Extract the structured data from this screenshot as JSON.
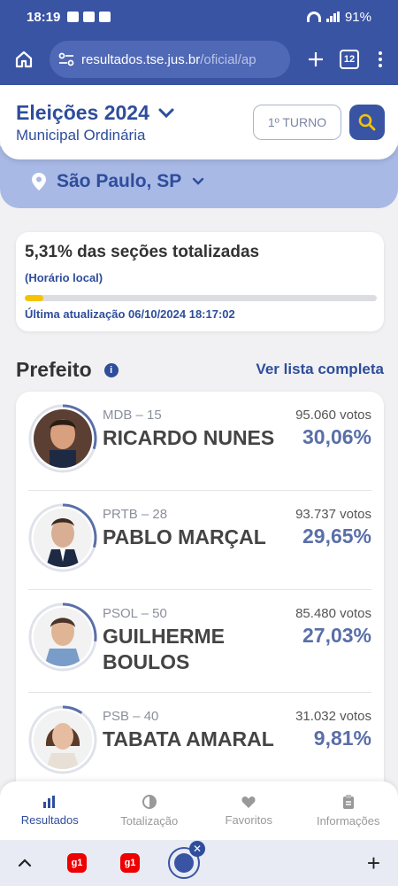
{
  "status_bar": {
    "time": "18:19",
    "battery": "91%"
  },
  "browser": {
    "url_host": "resultados.tse.jus.br",
    "url_path": "/oficial/ap",
    "tab_count": "12"
  },
  "header": {
    "title": "Eleições 2024",
    "subtitle": "Municipal Ordinária",
    "turno_label": "1º TURNO"
  },
  "location": {
    "label": "São Paulo, SP"
  },
  "progress": {
    "title": "5,31% das seções totalizadas",
    "local_time_note": "(Horário local)",
    "fraction": 0.0531,
    "updated": "Última atualização 06/10/2024 18:17:02"
  },
  "section": {
    "title": "Prefeito",
    "info_icon": "i",
    "see_all": "Ver lista completa"
  },
  "candidates": [
    {
      "party": "MDB – 15",
      "name": "RICARDO NUNES",
      "votes": "95.060 votos",
      "pct": "30,06%",
      "share": 0.3006
    },
    {
      "party": "PRTB – 28",
      "name": "PABLO MARÇAL",
      "votes": "93.737 votos",
      "pct": "29,65%",
      "share": 0.2965
    },
    {
      "party": "PSOL – 50",
      "name": "GUILHERME BOULOS",
      "votes": "85.480 votos",
      "pct": "27,03%",
      "share": 0.2703
    },
    {
      "party": "PSB – 40",
      "name": "TABATA AMARAL",
      "votes": "31.032 votos",
      "pct": "9,81%",
      "share": 0.0981
    }
  ],
  "bottom_nav": [
    {
      "label": "Resultados",
      "icon": "bar-chart-icon"
    },
    {
      "label": "Totalização",
      "icon": "pie-icon"
    },
    {
      "label": "Favoritos",
      "icon": "heart-icon"
    },
    {
      "label": "Informações",
      "icon": "clipboard-icon"
    }
  ],
  "tab_strip": {
    "g1_label": "g1",
    "close_glyph": "✕",
    "plus_glyph": "+"
  },
  "colors": {
    "brand": "#3a54a4",
    "accent_text": "#2e4d9c",
    "progress_fill": "#f5c400"
  }
}
